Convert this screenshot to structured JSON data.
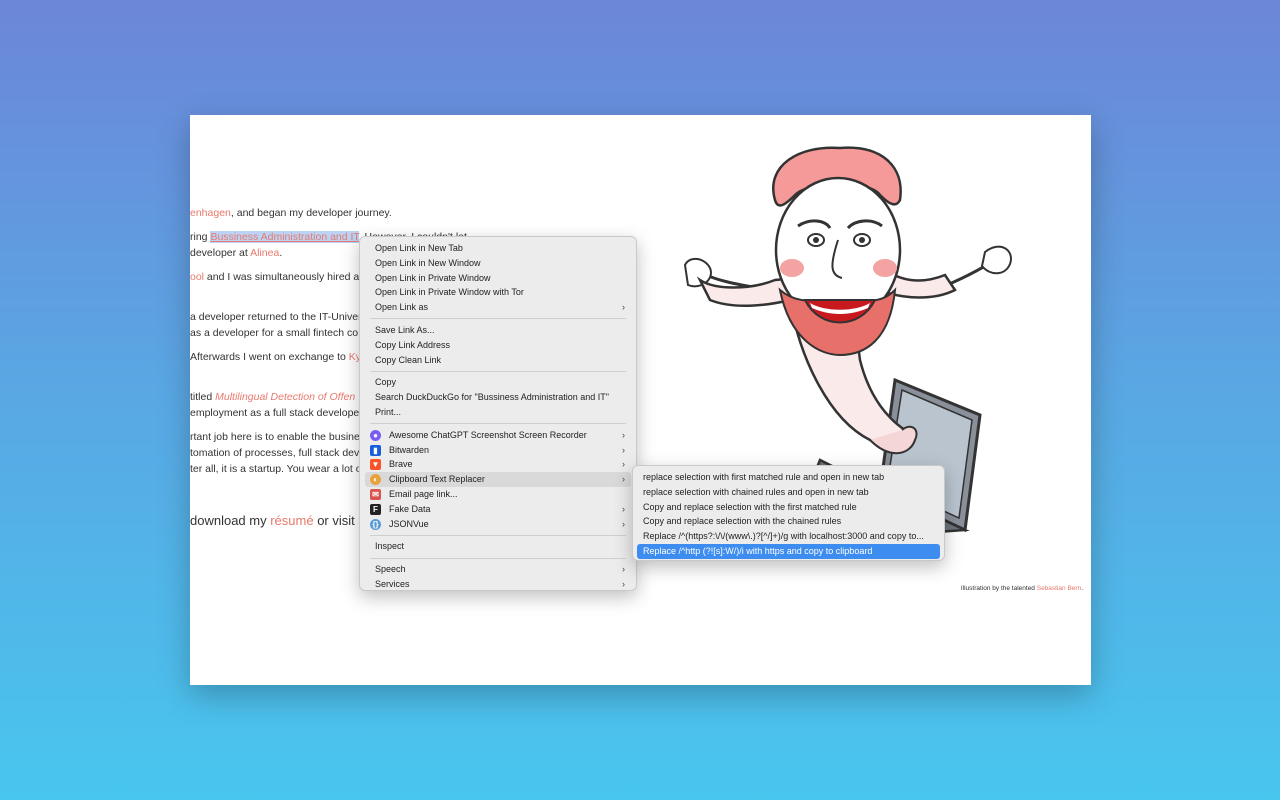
{
  "page": {
    "lines": [
      {
        "pre": "",
        "link": "enhagen",
        "post": ", and began my developer journey."
      },
      {
        "pre": "ring ",
        "selected": "Bussiness Administration and IT",
        "post": ". However, I couldn't let"
      },
      {
        "pre": "developer at ",
        "link": "Alinea",
        "post": "."
      },
      {
        "pre": "",
        "link": "ool",
        "post": " and I was simultaneously hired a"
      },
      {
        "pre": "a developer returned to the IT-Univer",
        "link": "",
        "post": ""
      },
      {
        "pre": "as a developer for a small fintech co",
        "link": "",
        "post": ""
      },
      {
        "pre": "Afterwards I went on exchange to ",
        "link": "Ky",
        "post": ""
      },
      {
        "pre": "titled ",
        "italic": "Multilingual Detection of Offen",
        "post": ""
      },
      {
        "pre": "employment as a full stack develope",
        "link": "",
        "post": ""
      },
      {
        "pre": "rtant job here is to enable the busine",
        "link": "",
        "post": ""
      },
      {
        "pre": "tomation of processes, full stack dev",
        "link": "",
        "post": ""
      },
      {
        "pre": "ter all, it is a startup. You wear a lot o",
        "link": "",
        "post": ""
      }
    ],
    "cta": {
      "pre": "download my ",
      "link": "résumé",
      "post": " or visit m"
    },
    "credit": {
      "pre": "Illustration by the talented ",
      "link": "Sebastian Bern",
      "post": "."
    }
  },
  "menu": {
    "group1": [
      "Open Link in New Tab",
      "Open Link in New Window",
      "Open Link in Private Window",
      "Open Link in Private Window with Tor",
      "Open Link as"
    ],
    "group2": [
      "Save Link As...",
      "Copy Link Address",
      "Copy Clean Link"
    ],
    "group3": [
      "Copy",
      "Search DuckDuckGo for \"Bussiness Administration and IT\"",
      "Print..."
    ],
    "extensions": [
      {
        "label": "Awesome ChatGPT Screenshot  Screen Recorder",
        "icon": "chatgpt-recorder-icon",
        "color": "#7b5cf5"
      },
      {
        "label": "Bitwarden",
        "icon": "bitwarden-icon",
        "color": "#175ddc"
      },
      {
        "label": "Brave",
        "icon": "brave-lion-icon",
        "color": "#fb542b"
      },
      {
        "label": "Clipboard Text Replacer",
        "icon": "clipboard-replacer-icon",
        "color": "#e8a23c"
      },
      {
        "label": "Email page link...",
        "icon": "email-icon",
        "color": "#d9534f"
      },
      {
        "label": "Fake Data",
        "icon": "fake-data-icon",
        "color": "#222222"
      },
      {
        "label": "JSONVue",
        "icon": "jsonvue-icon",
        "color": "#5b9bd5"
      }
    ],
    "inspect": "Inspect",
    "group5": [
      "Speech",
      "Services"
    ]
  },
  "submenu": {
    "items": [
      "replace selection with first matched rule and open in new tab",
      "replace selection with chained rules and open in new tab",
      "Copy and replace selection with the first matched rule",
      "Copy and replace selection with the chained rules",
      "Replace /^(https?:\\/\\/(www\\.)?[^/]+)/g with localhost:3000 and copy to...",
      "Replace /^http (?![s]:W/)/i with https and copy to clipboard"
    ]
  }
}
